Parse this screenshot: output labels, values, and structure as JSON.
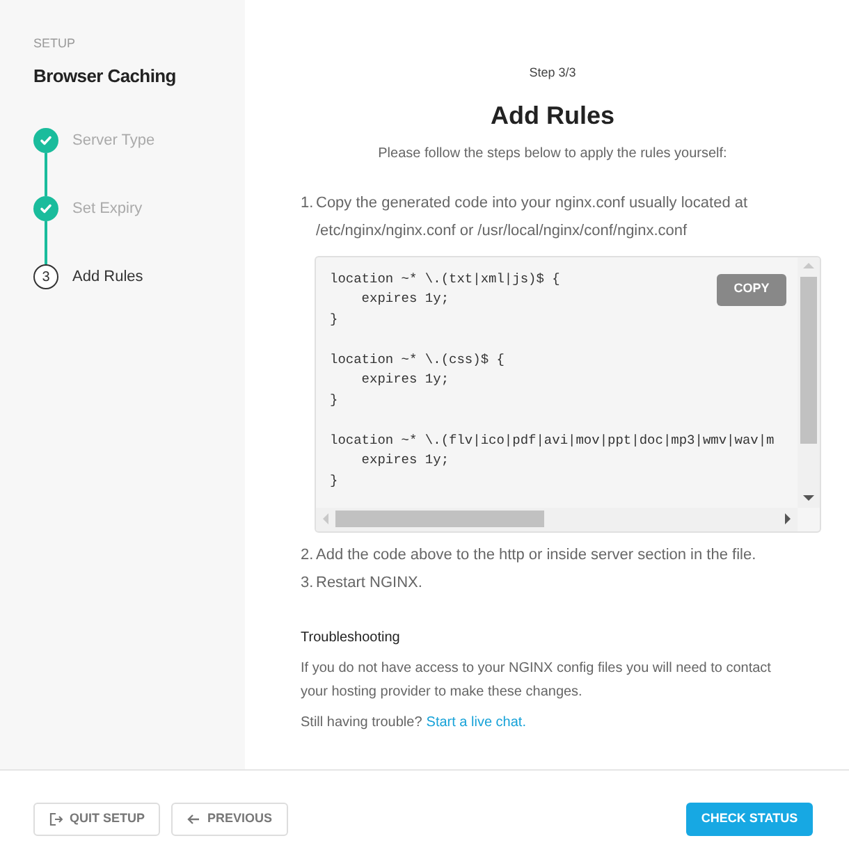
{
  "sidebar": {
    "section": "SETUP",
    "title": "Browser Caching",
    "steps": [
      {
        "label": "Server Type",
        "completed": true,
        "selected": false
      },
      {
        "label": "Set Expiry",
        "completed": true,
        "selected": false
      },
      {
        "number": "3",
        "label": "Add Rules",
        "completed": false,
        "selected": true
      }
    ]
  },
  "main": {
    "step": "Step 3/3",
    "title": "Add Rules",
    "subtitle": "Please follow the steps below to apply the rules yourself:",
    "instructions_before": [
      {
        "marker": "1.",
        "text": "Copy the generated code into your nginx.conf usually located at /etc/nginx/nginx.conf or /usr/local/nginx/conf/nginx.conf"
      }
    ],
    "code": {
      "blocks": [
        {
          "lines": [
            "location ~* \\.(txt|xml|js)$ {",
            "    expires 1y;",
            "}"
          ]
        },
        {
          "lines": [
            "location ~* \\.(css)$ {",
            "    expires 1y;",
            "}"
          ]
        },
        {
          "lines": [
            "location ~* \\.(flv|ico|pdf|avi|mov|ppt|doc|mp3|wmv|wav|m",
            "    expires 1y;",
            "}"
          ]
        }
      ],
      "copy_button": "COPY"
    },
    "instructions_after": [
      {
        "marker": "2.",
        "text": "Add the code above to the http or inside server section in the file."
      },
      {
        "marker": "3.",
        "text": "Restart NGINX."
      }
    ],
    "troubleshooting": {
      "heading": "Troubleshooting",
      "text": "If you do not have access to your NGINX config files you will need to contact your hosting provider to make these changes.",
      "prompt": "Still having trouble?",
      "link": "Start a live chat."
    }
  },
  "footer": {
    "quit": "QUIT SETUP",
    "previous": "PREVIOUS",
    "check": "CHECK STATUS"
  }
}
